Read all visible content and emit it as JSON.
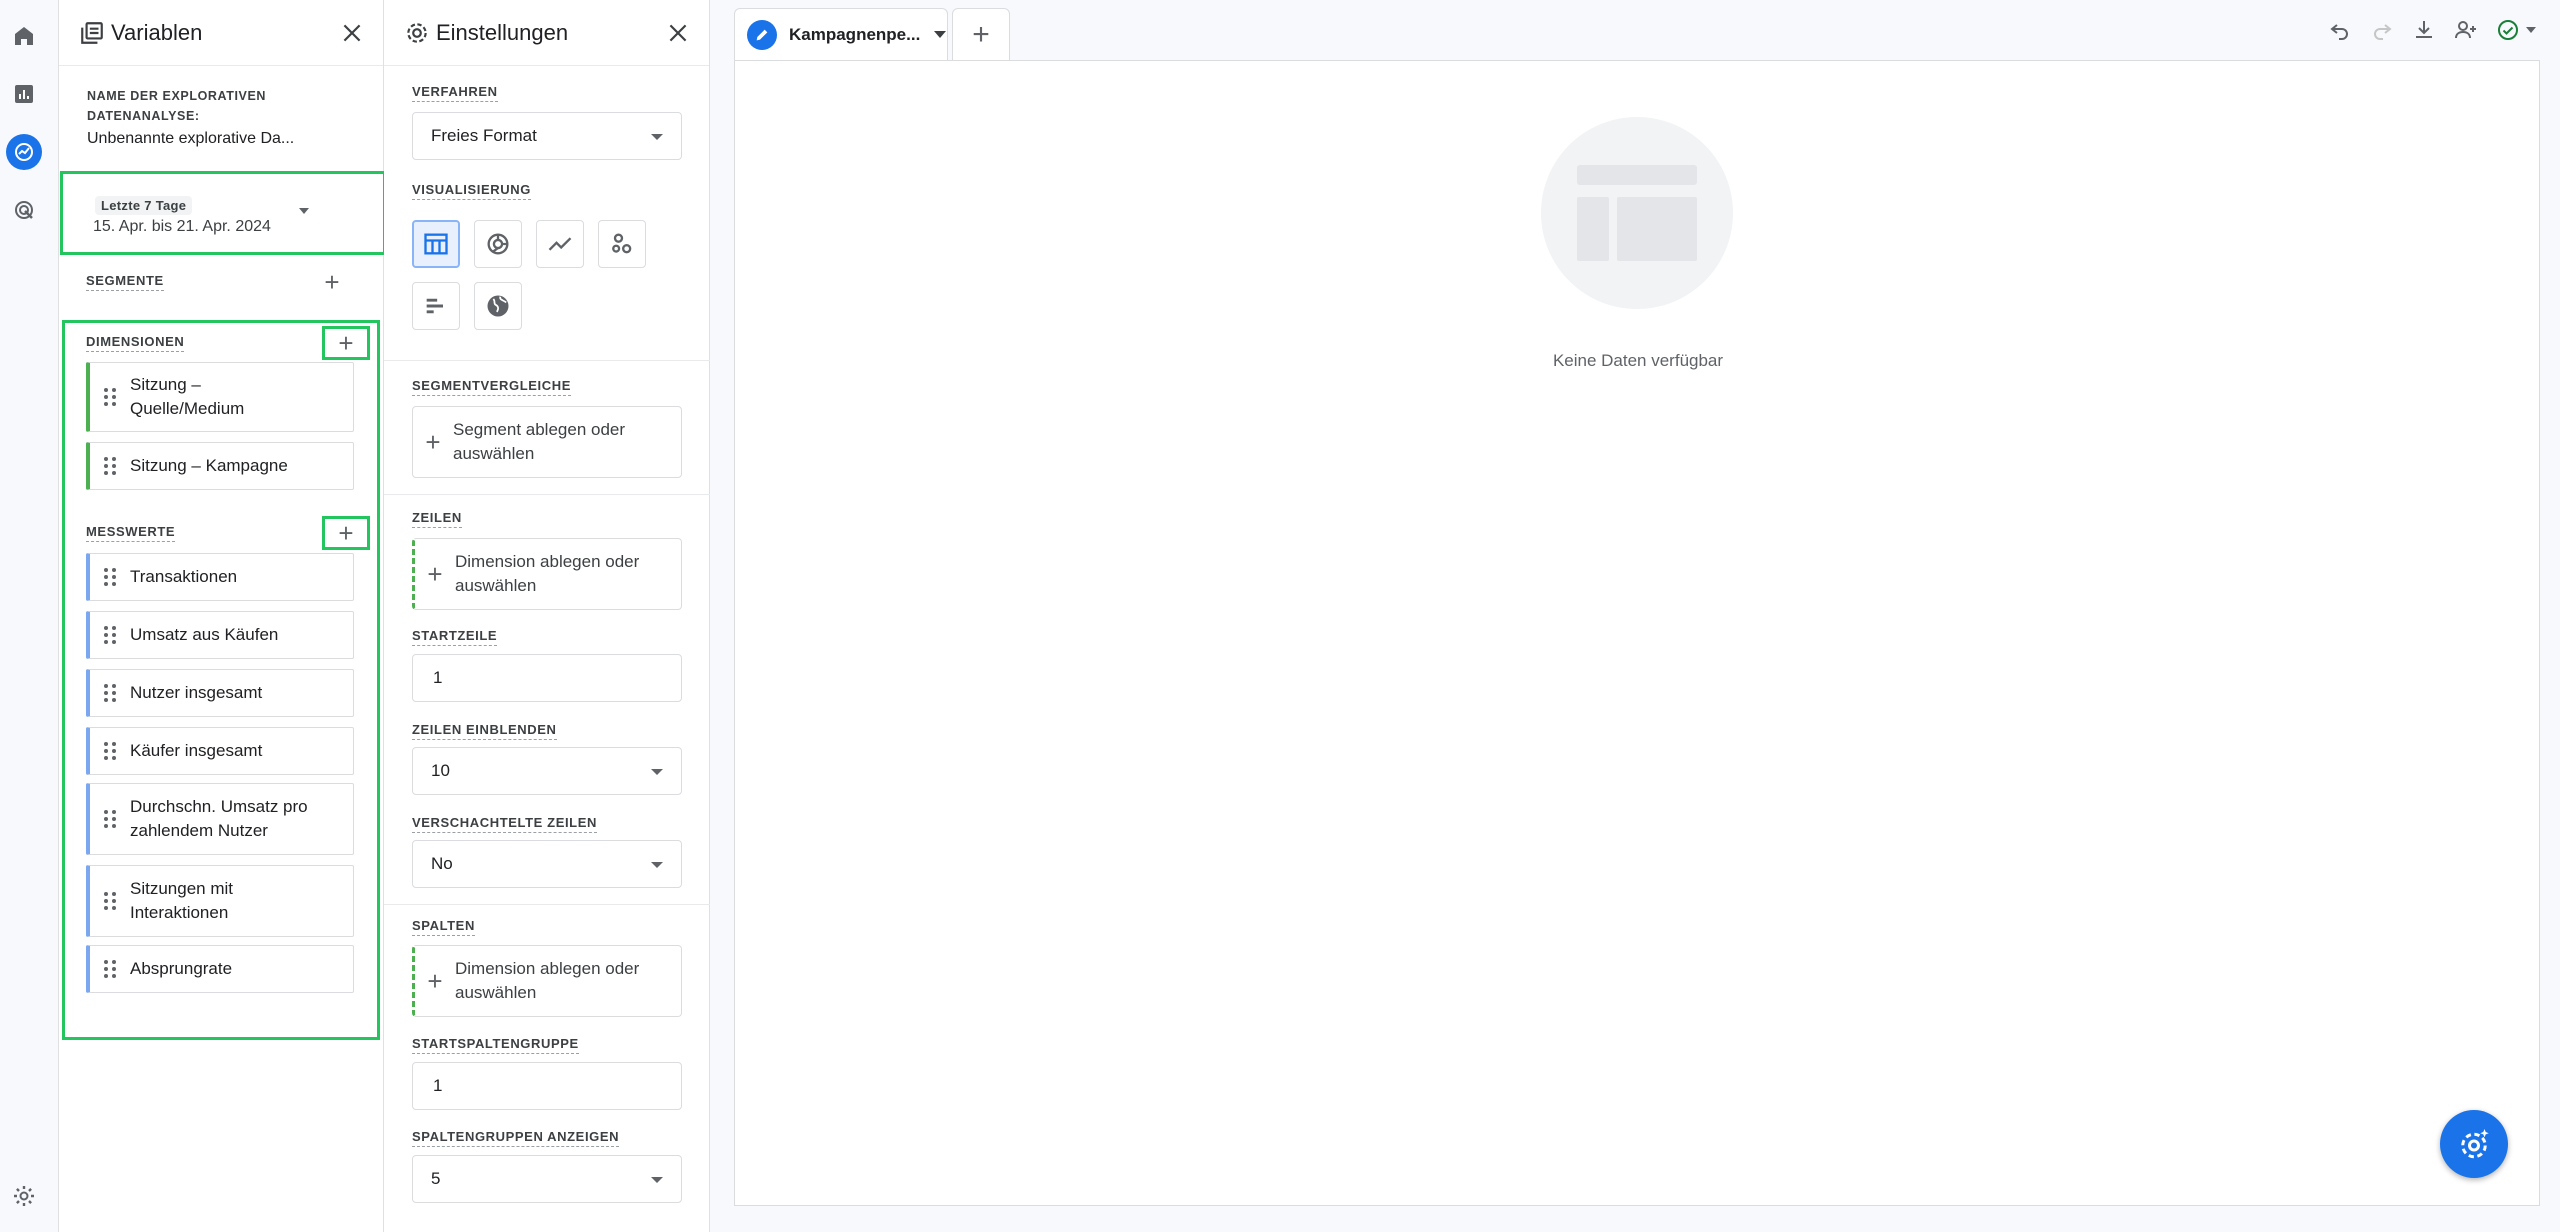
{
  "rail": {
    "items": [
      "home-icon",
      "reports-icon",
      "explore-icon",
      "advertising-icon"
    ],
    "settings_icon": "settings-icon"
  },
  "variables": {
    "title": "Variablen",
    "name_label": "NAME DER EXPLORATIVEN DATENANALYSE:",
    "name_value": "Unbenannte explorative Da...",
    "date_chip": "Letzte 7 Tage",
    "date_range": "15. Apr. bis 21. Apr. 2024",
    "segments_label": "SEGMENTE",
    "dimensions_label": "DIMENSIONEN",
    "dimensions": [
      {
        "label": "Sitzung –\nQuelle/Medium"
      },
      {
        "label": "Sitzung – Kampagne"
      }
    ],
    "metrics_label": "MESSWERTE",
    "metrics": [
      {
        "label": "Transaktionen"
      },
      {
        "label": "Umsatz aus Käufen"
      },
      {
        "label": "Nutzer insgesamt"
      },
      {
        "label": "Käufer insgesamt"
      },
      {
        "label": "Durchschn. Umsatz pro zahlendem Nutzer"
      },
      {
        "label": "Sitzungen mit Interaktionen"
      },
      {
        "label": "Absprungrate"
      }
    ]
  },
  "settings": {
    "title": "Einstellungen",
    "technique_label": "VERFAHREN",
    "technique_value": "Freies Format",
    "visualization_label": "VISUALISIERUNG",
    "segment_compare_label": "SEGMENTVERGLEICHE",
    "segment_drop": "Segment ablegen oder auswählen",
    "rows_label": "ZEILEN",
    "rows_drop": "Dimension ablegen oder auswählen",
    "start_row_label": "STARTZEILE",
    "start_row_value": "1",
    "show_rows_label": "ZEILEN EINBLENDEN",
    "show_rows_value": "10",
    "nested_rows_label": "VERSCHACHTELTE ZEILEN",
    "nested_rows_value": "No",
    "columns_label": "SPALTEN",
    "columns_drop": "Dimension ablegen oder auswählen",
    "start_col_group_label": "STARTSPALTENGRUPPE",
    "start_col_group_value": "1",
    "show_col_groups_label": "SPALTENGRUPPEN ANZEIGEN",
    "show_col_groups_value": "5"
  },
  "main": {
    "tab_name": "Kampagnenpe...",
    "empty_text": "Keine Daten verfügbar"
  },
  "colors": {
    "accent": "#1a73e8",
    "highlight": "#22c55e",
    "dimension": "#4caf50",
    "metric": "#7aa7f0"
  }
}
